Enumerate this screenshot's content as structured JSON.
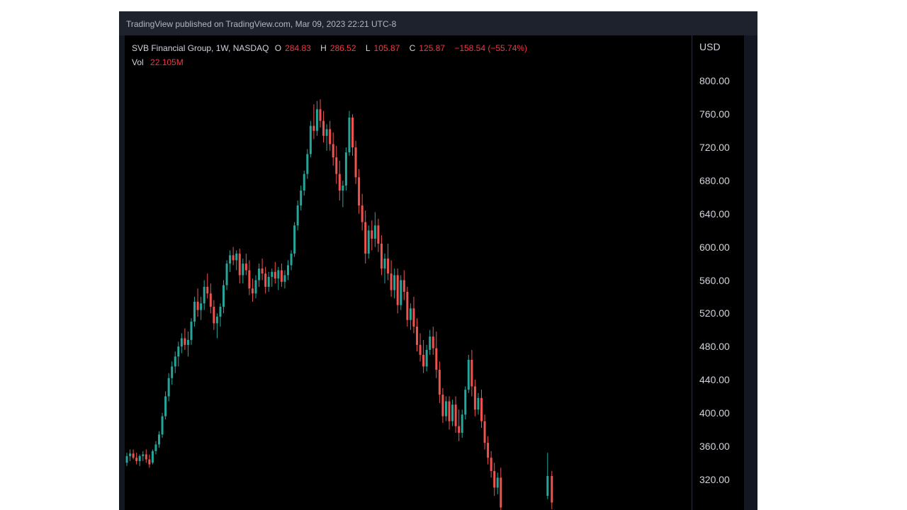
{
  "header": {
    "published": "TradingView published on TradingView.com, Mar 09, 2023 22:21 UTC-8"
  },
  "legend": {
    "symbol": "SVB Financial Group, 1W, NASDAQ",
    "o_label": "O",
    "o_value": "284.83",
    "h_label": "H",
    "h_value": "286.52",
    "l_label": "L",
    "l_value": "105.87",
    "c_label": "C",
    "c_value": "125.87",
    "change": "−158.54 (−55.74%)",
    "vol_label": "Vol",
    "vol_value": "22.105M"
  },
  "colors": {
    "up": "#26a69a",
    "down": "#ef5350",
    "background": "#000000"
  },
  "chart_data": {
    "type": "candlestick",
    "currency": "USD",
    "y_ticks": [
      800,
      760,
      720,
      680,
      640,
      600,
      560,
      520,
      480,
      440,
      400,
      360,
      320
    ],
    "y_tick_labels": [
      "800.00",
      "760.00",
      "720.00",
      "680.00",
      "640.00",
      "600.00",
      "560.00",
      "520.00",
      "480.00",
      "440.00",
      "400.00",
      "360.00",
      "320.00"
    ],
    "ylim": [
      283,
      855
    ],
    "candles": [
      [
        340,
        352,
        336,
        348
      ],
      [
        348,
        356,
        342,
        351
      ],
      [
        351,
        356,
        344,
        346
      ],
      [
        346,
        352,
        338,
        342
      ],
      [
        342,
        350,
        336,
        348
      ],
      [
        348,
        354,
        342,
        350
      ],
      [
        350,
        356,
        340,
        344
      ],
      [
        344,
        350,
        334,
        338
      ],
      [
        340,
        356,
        338,
        354
      ],
      [
        354,
        366,
        350,
        362
      ],
      [
        362,
        378,
        358,
        374
      ],
      [
        374,
        400,
        370,
        396
      ],
      [
        396,
        426,
        392,
        420
      ],
      [
        420,
        448,
        414,
        442
      ],
      [
        442,
        462,
        434,
        456
      ],
      [
        456,
        474,
        448,
        468
      ],
      [
        468,
        486,
        456,
        480
      ],
      [
        480,
        496,
        472,
        490
      ],
      [
        490,
        502,
        476,
        482
      ],
      [
        482,
        498,
        468,
        488
      ],
      [
        488,
        514,
        482,
        510
      ],
      [
        510,
        540,
        504,
        534
      ],
      [
        534,
        550,
        516,
        524
      ],
      [
        524,
        540,
        512,
        532
      ],
      [
        532,
        560,
        524,
        552
      ],
      [
        552,
        568,
        538,
        544
      ],
      [
        544,
        556,
        520,
        528
      ],
      [
        528,
        536,
        500,
        508
      ],
      [
        508,
        520,
        490,
        516
      ],
      [
        516,
        532,
        504,
        528
      ],
      [
        528,
        560,
        520,
        554
      ],
      [
        554,
        584,
        548,
        580
      ],
      [
        580,
        596,
        570,
        590
      ],
      [
        590,
        600,
        578,
        584
      ],
      [
        584,
        596,
        572,
        592
      ],
      [
        592,
        598,
        556,
        566
      ],
      [
        566,
        586,
        556,
        580
      ],
      [
        580,
        592,
        566,
        572
      ],
      [
        572,
        584,
        542,
        550
      ],
      [
        550,
        562,
        534,
        544
      ],
      [
        544,
        566,
        538,
        560
      ],
      [
        560,
        580,
        552,
        574
      ],
      [
        574,
        586,
        560,
        568
      ],
      [
        568,
        576,
        544,
        552
      ],
      [
        552,
        570,
        546,
        564
      ],
      [
        564,
        574,
        552,
        570
      ],
      [
        570,
        582,
        556,
        562
      ],
      [
        562,
        576,
        548,
        572
      ],
      [
        572,
        580,
        552,
        558
      ],
      [
        558,
        572,
        550,
        566
      ],
      [
        566,
        584,
        560,
        578
      ],
      [
        578,
        596,
        572,
        592
      ],
      [
        592,
        630,
        588,
        626
      ],
      [
        626,
        656,
        620,
        650
      ],
      [
        650,
        674,
        644,
        668
      ],
      [
        668,
        692,
        662,
        688
      ],
      [
        688,
        718,
        682,
        712
      ],
      [
        712,
        752,
        708,
        746
      ],
      [
        746,
        772,
        730,
        740
      ],
      [
        740,
        776,
        734,
        766
      ],
      [
        766,
        778,
        744,
        752
      ],
      [
        752,
        764,
        726,
        734
      ],
      [
        734,
        748,
        716,
        742
      ],
      [
        742,
        752,
        716,
        724
      ],
      [
        724,
        738,
        698,
        708
      ],
      [
        708,
        722,
        676,
        688
      ],
      [
        688,
        704,
        656,
        668
      ],
      [
        668,
        680,
        648,
        674
      ],
      [
        674,
        720,
        668,
        714
      ],
      [
        714,
        764,
        710,
        756
      ],
      [
        756,
        760,
        710,
        720
      ],
      [
        720,
        728,
        676,
        684
      ],
      [
        684,
        694,
        640,
        650
      ],
      [
        650,
        664,
        620,
        630
      ],
      [
        630,
        644,
        580,
        592
      ],
      [
        592,
        626,
        586,
        620
      ],
      [
        620,
        632,
        596,
        610
      ],
      [
        610,
        642,
        600,
        626
      ],
      [
        626,
        634,
        594,
        604
      ],
      [
        604,
        614,
        566,
        574
      ],
      [
        574,
        592,
        556,
        586
      ],
      [
        586,
        604,
        560,
        568
      ],
      [
        568,
        584,
        540,
        548
      ],
      [
        548,
        574,
        538,
        566
      ],
      [
        566,
        574,
        520,
        530
      ],
      [
        530,
        566,
        524,
        560
      ],
      [
        560,
        572,
        536,
        546
      ],
      [
        546,
        552,
        504,
        512
      ],
      [
        512,
        532,
        500,
        526
      ],
      [
        526,
        540,
        496,
        504
      ],
      [
        504,
        514,
        474,
        482
      ],
      [
        482,
        496,
        462,
        470
      ],
      [
        470,
        488,
        448,
        456
      ],
      [
        456,
        482,
        450,
        476
      ],
      [
        476,
        500,
        470,
        492
      ],
      [
        492,
        504,
        470,
        478
      ],
      [
        478,
        498,
        442,
        452
      ],
      [
        452,
        462,
        412,
        422
      ],
      [
        422,
        430,
        388,
        396
      ],
      [
        396,
        420,
        390,
        414
      ],
      [
        414,
        420,
        380,
        390
      ],
      [
        390,
        416,
        384,
        410
      ],
      [
        410,
        420,
        376,
        384
      ],
      [
        384,
        404,
        366,
        376
      ],
      [
        376,
        404,
        370,
        398
      ],
      [
        398,
        432,
        392,
        428
      ],
      [
        428,
        470,
        424,
        464
      ],
      [
        464,
        476,
        420,
        432
      ],
      [
        432,
        440,
        396,
        404
      ],
      [
        404,
        424,
        398,
        418
      ],
      [
        418,
        428,
        382,
        390
      ],
      [
        390,
        398,
        356,
        364
      ],
      [
        364,
        372,
        338,
        346
      ],
      [
        346,
        354,
        322,
        330
      ],
      [
        330,
        340,
        300,
        310
      ],
      [
        310,
        328,
        302,
        322
      ],
      [
        322,
        334,
        278,
        286
      ]
    ],
    "extra_candles": [
      [
        300,
        352,
        296,
        324
      ],
      [
        324,
        330,
        284,
        292
      ]
    ],
    "last": {
      "o": 284.83,
      "h": 286.52,
      "l": 105.87,
      "c": 125.87,
      "change": -158.54,
      "change_pct": -55.74
    },
    "volume": 22.105
  }
}
